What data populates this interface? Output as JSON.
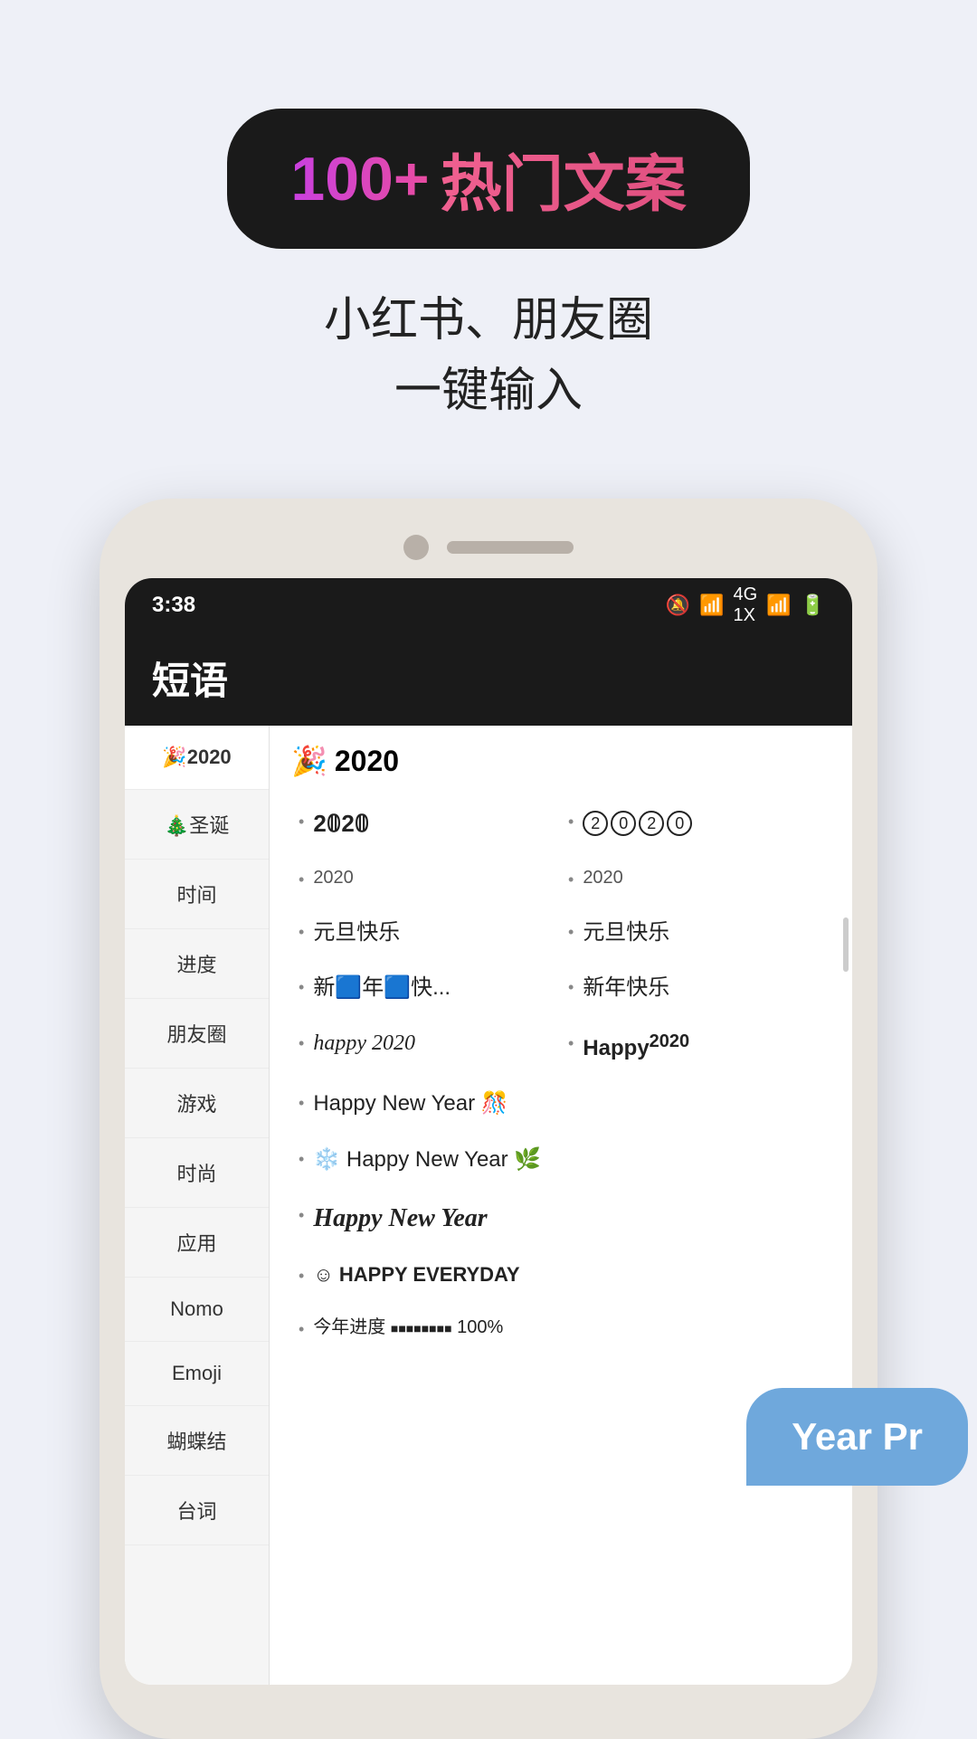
{
  "badge": {
    "number": "100+",
    "text": "热门文案"
  },
  "subtitle": {
    "line1": "小红书、朋友圈",
    "line2": "一键输入"
  },
  "status_bar": {
    "time": "3:38",
    "icons": "🔕 📶 4G 📶 🔋"
  },
  "app_header": {
    "title": "短语"
  },
  "sidebar": {
    "items": [
      {
        "label": "🎉2020",
        "active": true
      },
      {
        "label": "🎄圣诞",
        "active": false
      },
      {
        "label": "时间",
        "active": false
      },
      {
        "label": "进度",
        "active": false
      },
      {
        "label": "朋友圈",
        "active": false
      },
      {
        "label": "游戏",
        "active": false
      },
      {
        "label": "时尚",
        "active": false
      },
      {
        "label": "应用",
        "active": false
      },
      {
        "label": "Nomo",
        "active": false
      },
      {
        "label": "Emoji",
        "active": false
      },
      {
        "label": "蝴蝶结",
        "active": false
      },
      {
        "label": "台词",
        "active": false
      }
    ]
  },
  "main": {
    "section_title": "🎉2020",
    "items": [
      {
        "text": "2𝟘2𝟘",
        "col": 1,
        "style": "normal"
      },
      {
        "text": "②⓪②⓪",
        "col": 2,
        "style": "circle"
      },
      {
        "text": "2020",
        "col": 1,
        "style": "small"
      },
      {
        "text": "2020",
        "col": 2,
        "style": "small"
      },
      {
        "text": "元旦快乐",
        "col": 1,
        "style": "normal"
      },
      {
        "text": "元旦快乐",
        "col": 2,
        "style": "normal"
      },
      {
        "text": "新🟦年🟦快...",
        "col": 1,
        "style": "normal"
      },
      {
        "text": "新年快乐",
        "col": 2,
        "style": "normal"
      },
      {
        "text": "happy 2020",
        "col": 1,
        "style": "italic"
      },
      {
        "text": "Happy²⁰²⁰",
        "col": 2,
        "style": "bold"
      },
      {
        "text": "Happy New Year 🎊",
        "col": "full",
        "style": "normal"
      },
      {
        "text": "❄️ Happy New Year 🌿",
        "col": "full",
        "style": "normal"
      },
      {
        "text": "Happy New Year",
        "col": "full",
        "style": "cursive"
      },
      {
        "text": "☺ HAPPY EVERYDAY",
        "col": "full",
        "style": "small-caps"
      },
      {
        "text": "今年进度 ■■■■■■■■ 100%",
        "col": "full",
        "style": "progress"
      }
    ]
  },
  "tooltip": {
    "text": "Year Pr"
  }
}
